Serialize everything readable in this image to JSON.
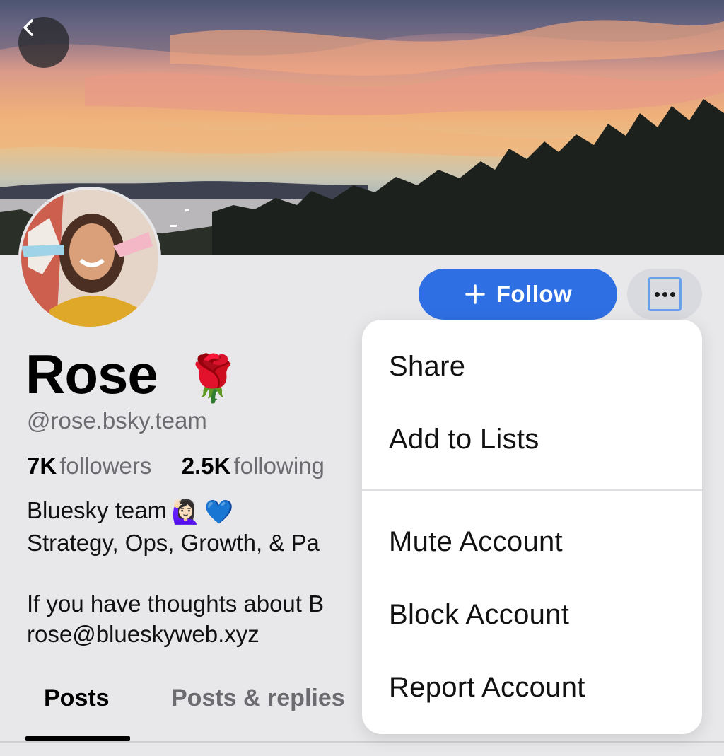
{
  "header": {
    "back_icon": "chevron-left-icon"
  },
  "profile": {
    "display_name": "Rose",
    "name_emoji": "🌹",
    "handle": "@rose.bsky.team",
    "followers_count": "7K",
    "followers_label": "followers",
    "following_count": "2.5K",
    "following_label": "following",
    "bio_line1": "Bluesky team",
    "bio_emoji1": "🙋🏻‍♀️",
    "bio_emoji2": "💙",
    "bio_line2": "Strategy, Ops, Growth, & Pa",
    "bio_line3": "If you have thoughts about B",
    "bio_line4": "rose@blueskyweb.xyz"
  },
  "actions": {
    "follow_label": "Follow",
    "follow_icon": "plus-icon",
    "more_icon": "ellipsis-icon",
    "accent_color": "#2f6fe4"
  },
  "tabs": [
    {
      "label": "Posts",
      "active": true
    },
    {
      "label": "Posts & replies",
      "active": false
    }
  ],
  "menu": {
    "items": [
      {
        "label": "Share"
      },
      {
        "label": "Add to Lists"
      },
      {
        "label": "Mute Account"
      },
      {
        "label": "Block Account"
      },
      {
        "label": "Report Account"
      }
    ]
  }
}
